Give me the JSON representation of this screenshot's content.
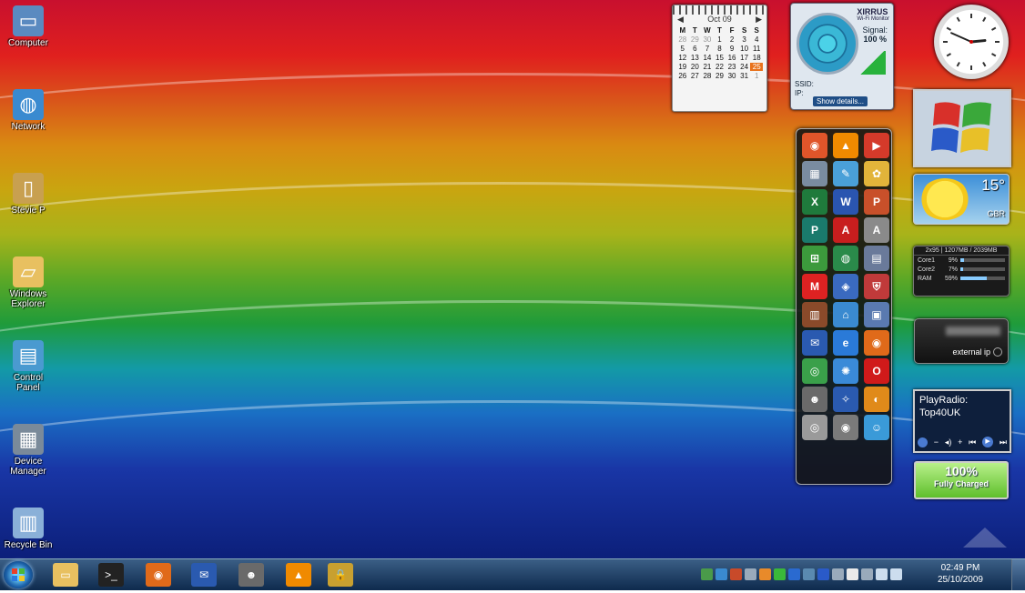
{
  "desktop": {
    "icons": [
      {
        "label": "Computer",
        "icon": "computer-icon"
      },
      {
        "label": "Network",
        "icon": "network-icon"
      },
      {
        "label": "Stevie P",
        "icon": "user-folder-icon"
      },
      {
        "label": "Windows Explorer",
        "icon": "folder-icon"
      },
      {
        "label": "Control Panel",
        "icon": "control-panel-icon"
      },
      {
        "label": "Device Manager",
        "icon": "device-manager-icon"
      },
      {
        "label": "Recycle Bin",
        "icon": "recycle-bin-icon"
      }
    ]
  },
  "calendar": {
    "month": "Oct 09",
    "prev": "◀",
    "next": "▶",
    "weekdays": [
      "M",
      "T",
      "W",
      "T",
      "F",
      "S",
      "S"
    ],
    "days": [
      "28",
      "29",
      "30",
      "1",
      "2",
      "3",
      "4",
      "5",
      "6",
      "7",
      "8",
      "9",
      "10",
      "11",
      "12",
      "13",
      "14",
      "15",
      "16",
      "17",
      "18",
      "19",
      "20",
      "21",
      "22",
      "23",
      "24",
      "25",
      "26",
      "27",
      "28",
      "29",
      "30",
      "31",
      "1"
    ],
    "dim_indices": [
      0,
      1,
      2,
      34
    ],
    "today_index": 27
  },
  "wifi": {
    "brand": "XIRRUS",
    "sub": "Wi-Fi Monitor",
    "signal_label": "Signal:",
    "signal_value": "100 %",
    "ssid_label": "SSID:",
    "ip_label": "IP:",
    "details_button": "Show details..."
  },
  "clock": {
    "hour": 2,
    "minute": 49
  },
  "weather": {
    "temp": "15°",
    "location": "GBR"
  },
  "cpu_meter": {
    "header": "2x95 | 1207MB / 2039MB",
    "rows": [
      {
        "name": "Core1",
        "value": "9%",
        "fraction": 0.09
      },
      {
        "name": "Core2",
        "value": "7%",
        "fraction": 0.07
      },
      {
        "name": "RAM",
        "value": "59%",
        "fraction": 0.59
      }
    ]
  },
  "ip_gadget": {
    "label": "external ip"
  },
  "radio": {
    "line1": "PlayRadio:",
    "line2": "Top40UK"
  },
  "battery": {
    "percent": "100%",
    "status": "Fully Charged"
  },
  "launcher": {
    "icons": [
      {
        "name": "firefox-app-icon",
        "color": "#e0552a",
        "glyph": "◉"
      },
      {
        "name": "vlc-icon",
        "color": "#f08a00",
        "glyph": "▲"
      },
      {
        "name": "media-player-icon",
        "color": "#d43a2a",
        "glyph": "▶"
      },
      {
        "name": "calculator-icon",
        "color": "#7a8ca0",
        "glyph": "▦"
      },
      {
        "name": "notepad-icon",
        "color": "#4aa0d8",
        "glyph": "✎"
      },
      {
        "name": "paint-icon",
        "color": "#e2b43a",
        "glyph": "✿"
      },
      {
        "name": "excel-icon",
        "color": "#1f7a3c",
        "glyph": "X"
      },
      {
        "name": "word-icon",
        "color": "#2a55b0",
        "glyph": "W"
      },
      {
        "name": "powerpoint-icon",
        "color": "#c8502a",
        "glyph": "P"
      },
      {
        "name": "publisher-icon",
        "color": "#1a7a6c",
        "glyph": "P"
      },
      {
        "name": "acrobat-icon",
        "color": "#c81e1e",
        "glyph": "A"
      },
      {
        "name": "access-icon",
        "color": "#8a8a8a",
        "glyph": "A"
      },
      {
        "name": "windows-live-icon",
        "color": "#3c9a3c",
        "glyph": "⊞"
      },
      {
        "name": "globe-icon",
        "color": "#2a8a4a",
        "glyph": "◍"
      },
      {
        "name": "task-manager-icon",
        "color": "#6a7a9a",
        "glyph": "▤"
      },
      {
        "name": "malwarebytes-icon",
        "color": "#d22",
        "glyph": "M"
      },
      {
        "name": "security-center-icon",
        "color": "#3a6ac0",
        "glyph": "◈"
      },
      {
        "name": "shield-icon",
        "color": "#c03a3a",
        "glyph": "⛨"
      },
      {
        "name": "firewall-icon",
        "color": "#8a4a2a",
        "glyph": "▥"
      },
      {
        "name": "network-map-icon",
        "color": "#3a8ad0",
        "glyph": "⌂"
      },
      {
        "name": "display-icon",
        "color": "#5a7ab0",
        "glyph": "▣"
      },
      {
        "name": "thunderbird-icon",
        "color": "#2a5ab0",
        "glyph": "✉"
      },
      {
        "name": "ie-icon",
        "color": "#2a7ad8",
        "glyph": "e"
      },
      {
        "name": "firefox-icon",
        "color": "#e06a1a",
        "glyph": "◉"
      },
      {
        "name": "chrome-icon",
        "color": "#3aa04a",
        "glyph": "◎"
      },
      {
        "name": "safari-icon",
        "color": "#3a8ad8",
        "glyph": "✺"
      },
      {
        "name": "opera-icon",
        "color": "#d01a1a",
        "glyph": "O"
      },
      {
        "name": "spy-icon",
        "color": "#6a6a6a",
        "glyph": "☻"
      },
      {
        "name": "flock-icon",
        "color": "#2a5ab0",
        "glyph": "✧"
      },
      {
        "name": "vlc-stream-icon",
        "color": "#e08a1a",
        "glyph": "◐"
      },
      {
        "name": "webcam-icon",
        "color": "#9a9a9a",
        "glyph": "◎"
      },
      {
        "name": "disc-icon",
        "color": "#7a7a7a",
        "glyph": "◉"
      },
      {
        "name": "messenger-icon",
        "color": "#3a9ad8",
        "glyph": "☺"
      }
    ]
  },
  "taskbar": {
    "pinned": [
      {
        "name": "taskbar-explorer",
        "icon": "folder-icon",
        "glyph": "▭",
        "color": "#e8c060"
      },
      {
        "name": "taskbar-cmd",
        "icon": "command-prompt-icon",
        "glyph": ">_",
        "color": "#222"
      },
      {
        "name": "taskbar-firefox",
        "icon": "firefox-icon",
        "glyph": "◉",
        "color": "#e06a1a"
      },
      {
        "name": "taskbar-thunderbird",
        "icon": "thunderbird-icon",
        "glyph": "✉",
        "color": "#2a5ab0"
      },
      {
        "name": "taskbar-spy",
        "icon": "spy-icon",
        "glyph": "☻",
        "color": "#6a6a6a"
      },
      {
        "name": "taskbar-vlc",
        "icon": "vlc-icon",
        "glyph": "▲",
        "color": "#f08a00"
      },
      {
        "name": "taskbar-lock",
        "icon": "lock-icon",
        "glyph": "🔒",
        "color": "#c8a030"
      }
    ],
    "time": "02:49 PM",
    "date": "25/10/2009"
  }
}
